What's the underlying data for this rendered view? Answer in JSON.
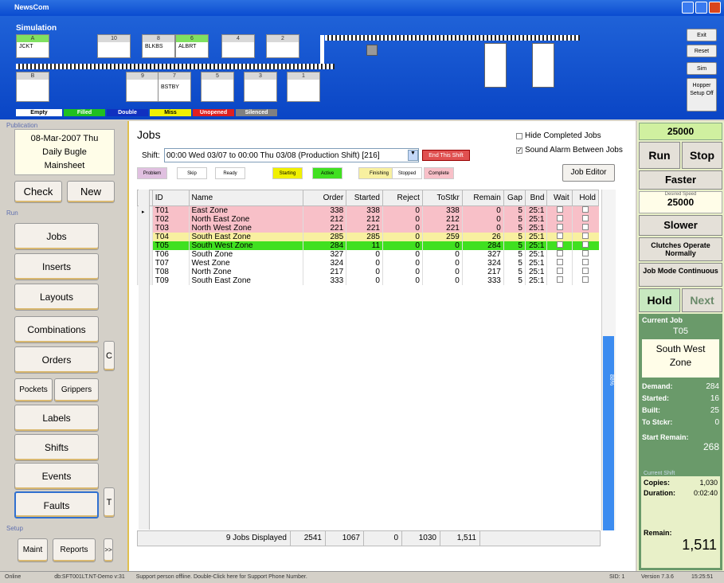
{
  "window": {
    "title": "NewsCom"
  },
  "sim": {
    "label": "Simulation",
    "top_hoppers": [
      {
        "n": "A",
        "l": "JCKT"
      },
      {
        "n": "10",
        "l": ""
      },
      {
        "n": "8",
        "l": "BLKBS"
      },
      {
        "n": "6",
        "l": "ALBRT"
      },
      {
        "n": "4",
        "l": ""
      },
      {
        "n": "2",
        "l": ""
      }
    ],
    "bottom_hoppers": [
      {
        "n": "B",
        "l": ""
      },
      {
        "n": "9",
        "l": ""
      },
      {
        "n": "7",
        "l": "BSTBY"
      },
      {
        "n": "5",
        "l": ""
      },
      {
        "n": "3",
        "l": ""
      },
      {
        "n": "1",
        "l": ""
      }
    ],
    "legend": [
      {
        "t": "Empty",
        "bg": "#ffffff",
        "c": "#000"
      },
      {
        "t": "Filled",
        "bg": "#20c020",
        "c": "#fff"
      },
      {
        "t": "Double",
        "bg": "#1030c0",
        "c": "#fff"
      },
      {
        "t": "Miss",
        "bg": "#f0f000",
        "c": "#000"
      },
      {
        "t": "Unopened",
        "bg": "#e02020",
        "c": "#fff"
      },
      {
        "t": "Silenced",
        "bg": "#808080",
        "c": "#fff"
      }
    ],
    "buttons": {
      "exit": "Exit",
      "reset": "Reset",
      "sim": "Sim",
      "hopper": "Hopper Setup Off"
    }
  },
  "publication": {
    "label": "Publication",
    "date": "08-Mar-2007 Thu",
    "paper": "Daily Bugle",
    "section": "Mainsheet"
  },
  "left": {
    "check": "Check",
    "new": "New",
    "run_label": "Run",
    "jobs": "Jobs",
    "inserts": "Inserts",
    "layouts": "Layouts",
    "combinations": "Combinations",
    "orders": "Orders",
    "c": "C",
    "pockets": "Pockets",
    "grippers": "Grippers",
    "labels": "Labels",
    "shifts": "Shifts",
    "events": "Events",
    "faults": "Faults",
    "t": "T",
    "setup_label": "Setup",
    "maint": "Maint",
    "reports": "Reports",
    "more": ">>"
  },
  "jobs": {
    "title": "Jobs",
    "hide_completed": "Hide Completed Jobs",
    "sound_alarm": "Sound Alarm Between Jobs",
    "shift_label": "Shift:",
    "shift_value": "00:00 Wed 03/07  to  00:00 Thu 03/08  (Production Shift) [216]",
    "end_shift": "End This Shift",
    "job_editor": "Job Editor",
    "states": [
      {
        "t": "Problem",
        "bg": "#e0c0e0"
      },
      {
        "t": "Skip",
        "bg": "#ffffff"
      },
      {
        "t": "Ready",
        "bg": "#ffffff"
      },
      {
        "t": "Starting",
        "bg": "#f0f000"
      },
      {
        "t": "Active",
        "bg": "#40e020"
      },
      {
        "t": "Finishing",
        "bg": "#f8f0a0"
      },
      {
        "t": "Stopped",
        "bg": "#ffffff"
      },
      {
        "t": "Complete",
        "bg": "#f8c0c8"
      }
    ],
    "columns": [
      "ID",
      "Name",
      "Order",
      "Started",
      "Reject",
      "ToStkr",
      "Remain",
      "Gap",
      "Bnd",
      "Wait",
      "Hold"
    ],
    "rows": [
      {
        "id": "T01",
        "name": "East Zone",
        "order": "338",
        "started": "338",
        "reject": "0",
        "tostkr": "338",
        "remain": "0",
        "gap": "5",
        "bnd": "25:1",
        "bg": "#f8c0c8"
      },
      {
        "id": "T02",
        "name": "North East Zone",
        "order": "212",
        "started": "212",
        "reject": "0",
        "tostkr": "212",
        "remain": "0",
        "gap": "5",
        "bnd": "25:1",
        "bg": "#f8c0c8"
      },
      {
        "id": "T03",
        "name": "North West Zone",
        "order": "221",
        "started": "221",
        "reject": "0",
        "tostkr": "221",
        "remain": "0",
        "gap": "5",
        "bnd": "25:1",
        "bg": "#f8c0c8"
      },
      {
        "id": "T04",
        "name": "South East Zone",
        "order": "285",
        "started": "285",
        "reject": "0",
        "tostkr": "259",
        "remain": "26",
        "gap": "5",
        "bnd": "25:1",
        "bg": "#f8f0a0"
      },
      {
        "id": "T05",
        "name": "South West Zone",
        "order": "284",
        "started": "11",
        "reject": "0",
        "tostkr": "0",
        "remain": "284",
        "gap": "5",
        "bnd": "25:1",
        "bg": "#40e020"
      },
      {
        "id": "T06",
        "name": "South Zone",
        "order": "327",
        "started": "0",
        "reject": "0",
        "tostkr": "0",
        "remain": "327",
        "gap": "5",
        "bnd": "25:1",
        "bg": "#ffffff"
      },
      {
        "id": "T07",
        "name": "West Zone",
        "order": "324",
        "started": "0",
        "reject": "0",
        "tostkr": "0",
        "remain": "324",
        "gap": "5",
        "bnd": "25:1",
        "bg": "#ffffff"
      },
      {
        "id": "T08",
        "name": "North Zone",
        "order": "217",
        "started": "0",
        "reject": "0",
        "tostkr": "0",
        "remain": "217",
        "gap": "5",
        "bnd": "25:1",
        "bg": "#ffffff"
      },
      {
        "id": "T09",
        "name": "South East Zone",
        "order": "333",
        "started": "0",
        "reject": "0",
        "tostkr": "0",
        "remain": "333",
        "gap": "5",
        "bnd": "25:1",
        "bg": "#ffffff"
      }
    ],
    "footer": {
      "displayed": "9 Jobs Displayed",
      "order": "2541",
      "started": "1067",
      "reject": "0",
      "tostkr": "1030",
      "remain": "1,511"
    },
    "side_label": "88%"
  },
  "right": {
    "speed": "25000",
    "run": "Run",
    "stop": "Stop",
    "faster": "Faster",
    "desired_label": "Desired Speed",
    "desired": "25000",
    "slower": "Slower",
    "clutches": "Clutches Operate Normally",
    "jobmode": "Job Mode Continuous",
    "hold": "Hold",
    "next": "Next",
    "current_job_label": "Current Job",
    "current_job_id": "T05",
    "current_job_name": "South West Zone",
    "demand_l": "Demand:",
    "demand": "284",
    "started_l": "Started:",
    "started": "16",
    "built_l": "Built:",
    "built": "25",
    "tostkr_l": "To Stckr:",
    "tostkr": "0",
    "start_remain_l": "Start Remain:",
    "start_remain": "268",
    "shift_label": "Current Shift",
    "copies_l": "Copies:",
    "copies": "1,030",
    "duration_l": "Duration:",
    "duration": "0:02:40",
    "remain_l": "Remain:",
    "remain": "1,511"
  },
  "status": {
    "online": "Online",
    "db": "db:SFT001LT.NT-Demo   v:31",
    "support": "Support person offline.  Double-Click here for Support Phone Number.",
    "sid": "SID: 1",
    "version": "Version 7.3.6",
    "time": "15:25:51"
  }
}
